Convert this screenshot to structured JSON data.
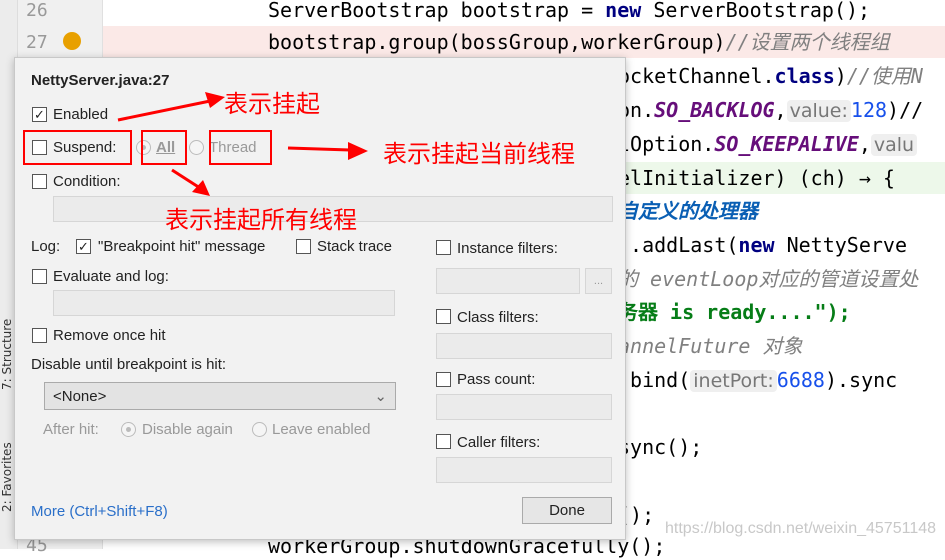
{
  "editor": {
    "line_numbers": [
      "26",
      "27",
      "45"
    ],
    "line26": {
      "a": "ServerBootstrap bootstrap = ",
      "kw": "new",
      "b": " ServerBootstrap();"
    },
    "line27": {
      "a": "bootstrap.group(bossGroup,workerGroup)",
      "cm": "//设置两个线程组"
    },
    "l28": {
      "a": "ocketChannel.",
      "kw": "class",
      "b": ")",
      "cm": "//使用N"
    },
    "l29": {
      "a": "on.",
      "fd": "SO_BACKLOG",
      "b": ",",
      "hint": "value:",
      "num": "128",
      "c": ")//"
    },
    "l30": {
      "a": "lOption.",
      "fd": "SO_KEEPALIVE",
      "b": ",",
      "hint": "valu"
    },
    "l31": "elInitializer) (ch) → {",
    "l32": "自定义的处理器",
    "l33": {
      "a": ").addLast(",
      "kw": "new",
      "b": " NettyServe"
    },
    "l34": "的 eventLoop对应的管道设置处",
    "l35": "务器 is ready....\");",
    "l36": "annelFuture 对象",
    "l37": {
      "a": ".bind(",
      "hint": "inetPort:",
      "num": "6688",
      "b": ").sync"
    },
    "l39": "sync();",
    "l41": "();",
    "line45": "workerGroup.shutdownGracefully();",
    "watermark": "https://blog.csdn.net/weixin_45751148"
  },
  "side_tabs": [
    "7: Structure",
    "2: Favorites"
  ],
  "dialog": {
    "title": "NettyServer.java:27",
    "enabled": {
      "label": "Enabled",
      "checked": true
    },
    "suspend": {
      "label": "Suspend:",
      "checked": false
    },
    "suspend_all": {
      "label": "All",
      "selected": true
    },
    "suspend_thread": {
      "label": "Thread",
      "selected": false
    },
    "condition": {
      "label": "Condition:",
      "checked": false,
      "value": ""
    },
    "log_label": "Log:",
    "log_message": {
      "label": "\"Breakpoint hit\" message",
      "checked": true
    },
    "stack_trace": {
      "label": "Stack trace",
      "checked": false
    },
    "evaluate_and_log": {
      "label": "Evaluate and log:",
      "checked": false,
      "value": ""
    },
    "remove_once_hit": {
      "label": "Remove once hit",
      "checked": false
    },
    "disable_until_label": "Disable until breakpoint is hit:",
    "disable_until_value": "<None>",
    "after_hit_label": "After hit:",
    "disable_again": {
      "label": "Disable again",
      "selected": true
    },
    "leave_enabled": {
      "label": "Leave enabled",
      "selected": false
    },
    "instance_filters": {
      "label": "Instance filters:",
      "checked": false,
      "button": "..."
    },
    "class_filters": {
      "label": "Class filters:",
      "checked": false
    },
    "pass_count": {
      "label": "Pass count:",
      "checked": false
    },
    "caller_filters": {
      "label": "Caller filters:",
      "checked": false
    },
    "more_link": "More (Ctrl+Shift+F8)",
    "done_button": "Done"
  },
  "annotations": {
    "suspend": "表示挂起",
    "thread": "表示挂起当前线程",
    "all": "表示挂起所有线程",
    "color": "#ff0000"
  }
}
